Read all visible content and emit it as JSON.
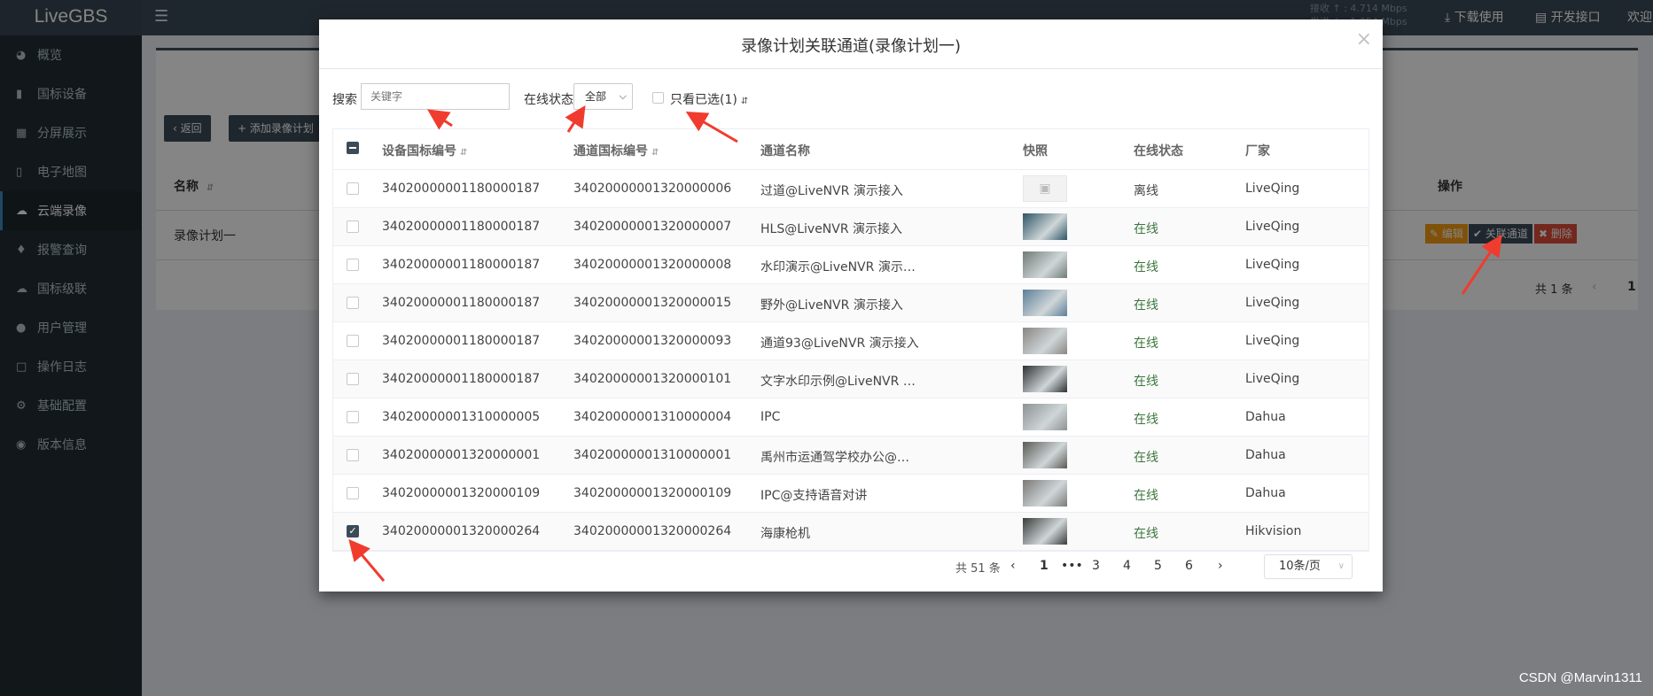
{
  "app": {
    "logo": "LiveGBS"
  },
  "topbar": {
    "speed_in": "接收 ↑ : 4.714 Mbps",
    "speed_out": "发送 ↓ : 1.054 Mbps",
    "download": "下载使用",
    "dev_api": "开发接口",
    "welcome": "欢迎"
  },
  "sidebar": {
    "items": [
      {
        "label": "概览",
        "icon": "dashboard-icon"
      },
      {
        "label": "国标设备",
        "icon": "video-camera-icon"
      },
      {
        "label": "分屏展示",
        "icon": "grid-icon"
      },
      {
        "label": "电子地图",
        "icon": "map-icon"
      },
      {
        "label": "云端录像",
        "icon": "cloud-icon"
      },
      {
        "label": "报警查询",
        "icon": "bell-icon"
      },
      {
        "label": "国标级联",
        "icon": "cloud-upload-icon"
      },
      {
        "label": "用户管理",
        "icon": "users-icon"
      },
      {
        "label": "操作日志",
        "icon": "file-icon"
      },
      {
        "label": "基础配置",
        "icon": "cogs-icon"
      },
      {
        "label": "版本信息",
        "icon": "globe-icon"
      }
    ],
    "active_index": 4
  },
  "background": {
    "back_button": "返回",
    "add_plan_button": "添加录像计划",
    "col_name": "名称",
    "col_operation": "操作",
    "row_name": "录像计划一",
    "edit_button": "编辑",
    "link_channel_button": "关联通道",
    "delete_button": "删除",
    "total": "共 1 条",
    "page": "1"
  },
  "modal": {
    "title": "录像计划关联通道(录像计划一)",
    "close": "×",
    "search_label": "搜索",
    "search_placeholder": "关键字",
    "status_label": "在线状态",
    "status_value": "全部",
    "only_selected_label": "只看已选(1)",
    "columns": {
      "device_id": "设备国标编号",
      "channel_id": "通道国标编号",
      "channel_name": "通道名称",
      "snapshot": "快照",
      "online": "在线状态",
      "vendor": "厂家"
    },
    "rows": [
      {
        "device_id": "34020000001180000187",
        "channel_id": "34020000001320000006",
        "channel_name": "过道@LiveNVR 演示接入",
        "online": "离线",
        "vendor": "LiveQing",
        "checked": false,
        "thumb": "placeholder"
      },
      {
        "device_id": "34020000001180000187",
        "channel_id": "34020000001320000007",
        "channel_name": "HLS@LiveNVR 演示接入",
        "online": "在线",
        "vendor": "LiveQing",
        "checked": false,
        "thumb": "#2e5566"
      },
      {
        "device_id": "34020000001180000187",
        "channel_id": "34020000001320000008",
        "channel_name": "水印演示@LiveNVR 演示…",
        "online": "在线",
        "vendor": "LiveQing",
        "checked": false,
        "thumb": "#6f7c76"
      },
      {
        "device_id": "34020000001180000187",
        "channel_id": "34020000001320000015",
        "channel_name": "野外@LiveNVR 演示接入",
        "online": "在线",
        "vendor": "LiveQing",
        "checked": false,
        "thumb": "#5d7f9a"
      },
      {
        "device_id": "34020000001180000187",
        "channel_id": "34020000001320000093",
        "channel_name": "通道93@LiveNVR 演示接入",
        "online": "在线",
        "vendor": "LiveQing",
        "checked": false,
        "thumb": "#8a8583"
      },
      {
        "device_id": "34020000001180000187",
        "channel_id": "34020000001320000101",
        "channel_name": "文字水印示例@LiveNVR …",
        "online": "在线",
        "vendor": "LiveQing",
        "checked": false,
        "thumb": "#2f3031"
      },
      {
        "device_id": "34020000001310000005",
        "channel_id": "34020000001310000004",
        "channel_name": "IPC",
        "online": "在线",
        "vendor": "Dahua",
        "checked": false,
        "thumb": "#8d9293"
      },
      {
        "device_id": "34020000001320000001",
        "channel_id": "34020000001310000001",
        "channel_name": "禹州市运通驾学校办公@…",
        "online": "在线",
        "vendor": "Dahua",
        "checked": false,
        "thumb": "#5a5b55"
      },
      {
        "device_id": "34020000001320000109",
        "channel_id": "34020000001320000109",
        "channel_name": "IPC@支持语音对讲",
        "online": "在线",
        "vendor": "Dahua",
        "checked": false,
        "thumb": "#7b7a77"
      },
      {
        "device_id": "34020000001320000264",
        "channel_id": "34020000001320000264",
        "channel_name": "海康枪机",
        "online": "在线",
        "vendor": "Hikvision",
        "checked": true,
        "thumb": "#3a3c3a"
      }
    ],
    "pager": {
      "total": "共 51 条",
      "pages": [
        "1",
        "•••",
        "3",
        "4",
        "5",
        "6"
      ],
      "current": "1",
      "page_size": "10条/页"
    }
  },
  "watermark": "CSDN @Marvin1311",
  "colors": {
    "sidebar": "#222d32",
    "header": "#3c4b58",
    "online_green": "#3c763d",
    "arrow_red": "#f03c2e"
  }
}
